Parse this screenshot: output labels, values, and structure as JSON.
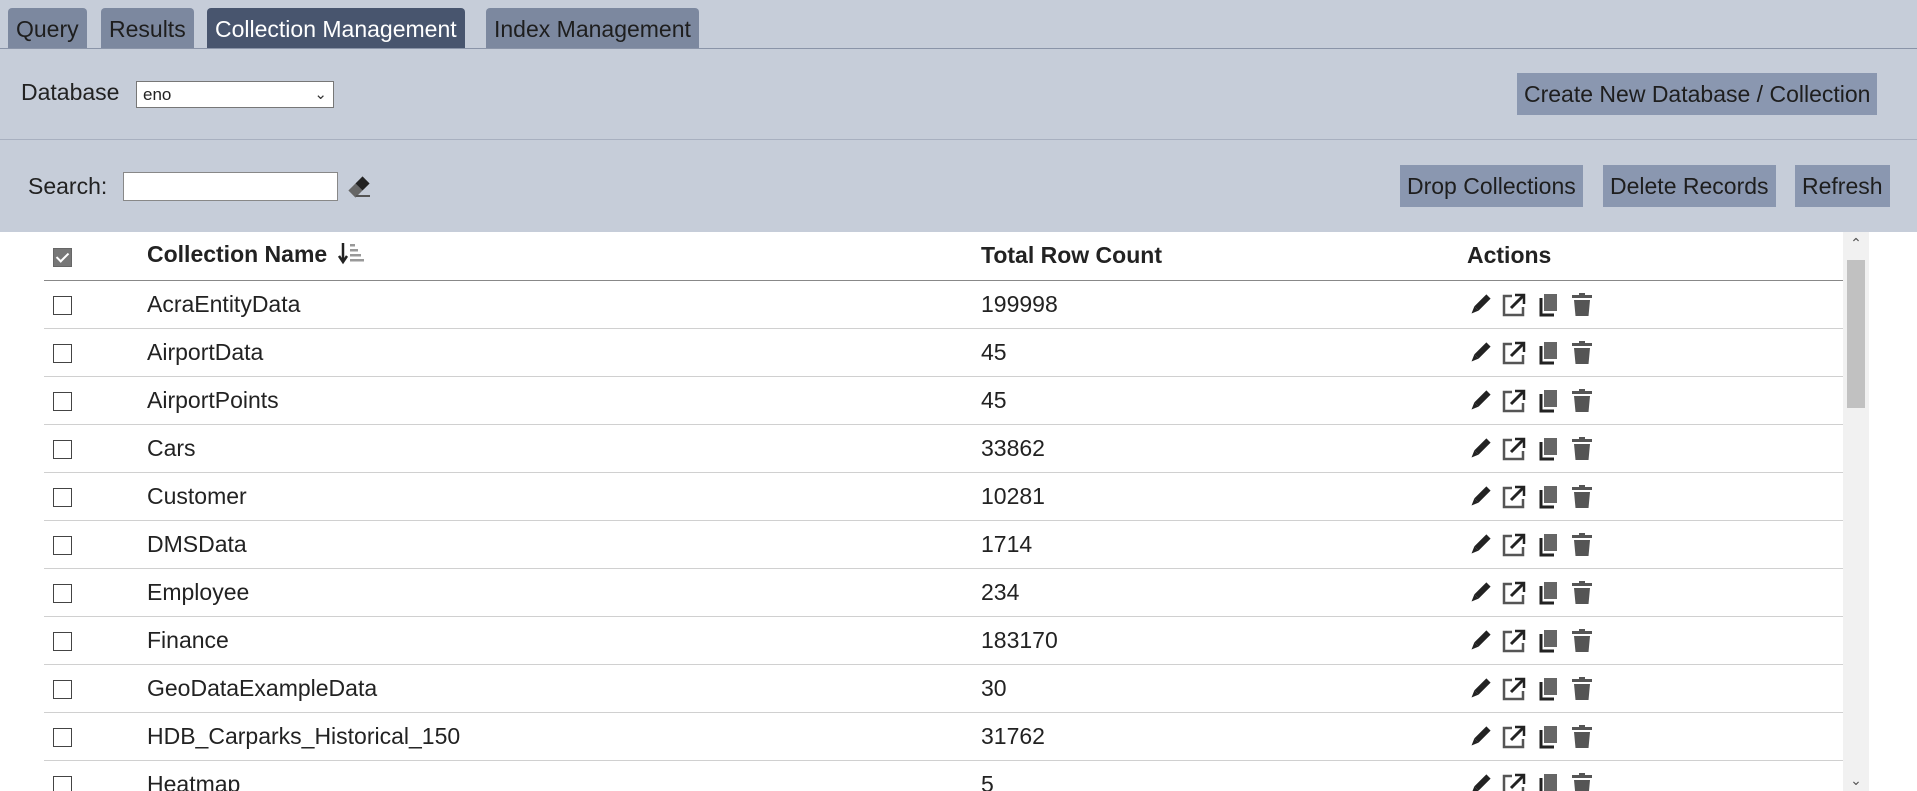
{
  "tabs": [
    {
      "label": "Query"
    },
    {
      "label": "Results"
    },
    {
      "label": "Collection Management"
    },
    {
      "label": "Index Management"
    }
  ],
  "database": {
    "label": "Database",
    "selected": "eno",
    "create_button": "Create New Database / Collection"
  },
  "search": {
    "label": "Search:",
    "value": "",
    "placeholder": ""
  },
  "toolbar": {
    "drop_label": "Drop Collections",
    "delete_label": "Delete Records",
    "refresh_label": "Refresh"
  },
  "table": {
    "headers": {
      "name": "Collection Name",
      "count": "Total Row Count",
      "actions": "Actions"
    },
    "rows": [
      {
        "name": "AcraEntityData",
        "count": "199998"
      },
      {
        "name": "AirportData",
        "count": "45"
      },
      {
        "name": "AirportPoints",
        "count": "45"
      },
      {
        "name": "Cars",
        "count": "33862"
      },
      {
        "name": "Customer",
        "count": "10281"
      },
      {
        "name": "DMSData",
        "count": "1714"
      },
      {
        "name": "Employee",
        "count": "234"
      },
      {
        "name": "Finance",
        "count": "183170"
      },
      {
        "name": "GeoDataExampleData",
        "count": "30"
      },
      {
        "name": "HDB_Carparks_Historical_150",
        "count": "31762"
      },
      {
        "name": "Heatmap",
        "count": "5"
      }
    ]
  },
  "colors": {
    "tab_active": "#48556e",
    "tab_inactive": "#7c889f",
    "panel_bg": "#c6cdd9",
    "button_bg": "#8a97b0"
  }
}
